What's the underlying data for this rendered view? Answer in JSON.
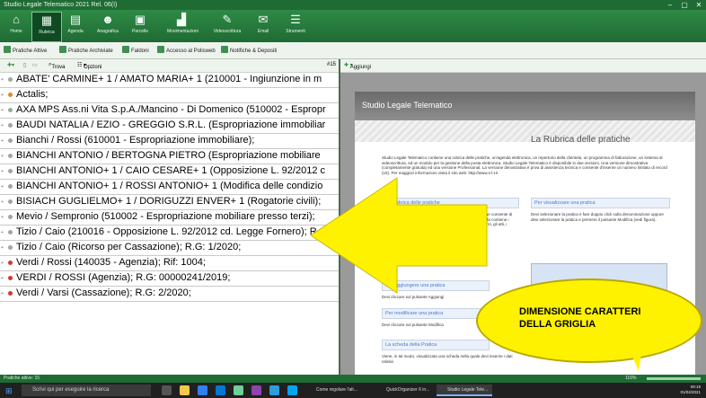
{
  "window": {
    "title": "Studio Legale Telematico 2021 Rel. 06(I)"
  },
  "ribbon": {
    "items": [
      {
        "label": "Home"
      },
      {
        "label": "Rubrica"
      },
      {
        "label": "Agenda"
      },
      {
        "label": "Anagrafica"
      },
      {
        "label": "Parcelle"
      },
      {
        "label": "Movimentazioni"
      },
      {
        "label": "Videoscrittura"
      },
      {
        "label": "Email"
      },
      {
        "label": "Strumenti"
      }
    ]
  },
  "subbar": {
    "items": [
      {
        "label": "Pratiche Attive"
      },
      {
        "label": "Pratiche Archiviate"
      },
      {
        "label": "Faldoni"
      },
      {
        "label": "Accesso al Polisweb"
      },
      {
        "label": "Notifiche & Depositi"
      }
    ]
  },
  "left_toolbar": {
    "find": "Trova",
    "options": "Opzioni",
    "count": "#15"
  },
  "right_toolbar": {
    "add": "Aggiungi"
  },
  "grid": {
    "rows": [
      {
        "text": "ABATE' CARMINE+ 1 / AMATO MARIA+ 1 (210001 - Ingiunzione in m",
        "status": "green"
      },
      {
        "text": "Actalis;",
        "status": "orange"
      },
      {
        "text": "AXA MPS Ass.ni Vita S.p.A./Mancino - Di Domenico (510002 - Espropr",
        "status": "green"
      },
      {
        "text": "BAUDI NATALIA / EZIO - GREGGIO S.R.L. (Espropriazione immobiliar",
        "status": "green"
      },
      {
        "text": "Bianchi / Rossi (610001 - Espropriazione immobiliare);",
        "status": "green"
      },
      {
        "text": "BIANCHI ANTONIO / BERTOGNA PIETRO (Espropriazione mobiliare",
        "status": "green"
      },
      {
        "text": "BIANCHI ANTONIO+ 1 / CAIO CESARE+ 1 (Opposizione L. 92/2012 c",
        "status": "green"
      },
      {
        "text": "BIANCHI ANTONIO+ 1 / ROSSI ANTONIO+ 1 (Modifica delle condizio",
        "status": "green"
      },
      {
        "text": "BISIACH GUGLIELMO+ 1 / DORIGUZZI ENVER+ 1 (Rogatorie civili);",
        "status": "green"
      },
      {
        "text": "Mevio / Sempronio (510002 - Espropriazione mobiliare presso terzi);",
        "status": "green"
      },
      {
        "text": "Tizio / Caio (210016 - Opposizione L. 92/2012 cd. Legge Fornero); R.G",
        "status": "green"
      },
      {
        "text": "Tizio / Caio (Ricorso per Cassazione); R.G: 1/2020;",
        "status": "green"
      },
      {
        "text": "Verdi / Rossi (140035 - Agenzia); Rif: 1004;",
        "status": "red"
      },
      {
        "text": "VERDI / ROSSI (Agenzia); R.G: 00000241/2019;",
        "status": "red"
      },
      {
        "text": "Verdi / Varsi (Cassazione); R.G: 2/2020;",
        "status": "red"
      }
    ]
  },
  "doc": {
    "header": "Studio Legale Telematico",
    "title": "La Rubrica delle pratiche",
    "intro": "Studio Legale Telematico contiene una rubrica delle pratiche, un'agenda elettronica, un repertorio della clientela, un programma di fatturazione, un sistema di videoscrittura, ed un modulo per la gestione della posta elettronica. Studio Legale Telematico è disponibile in due versioni. Una versione dimostrativa (completamente gratuita) ed una versione Professional. La versione dimostrativa è priva di assistenza tecnica e consente d'inserire un numero limitato di record (15). Per maggiori informazioni visita il sito web: http://www.s-l-t.it",
    "sections": [
      {
        "title": "La Rubrica delle pratiche",
        "body": "Il modulo principale del programma. La rubrica delle pratiche consente di raggruppare, in un'unica tabella, tutte le attività. Ogni cartella contiene i clienti, le controparti, i corrispondenti, le udienze, i documenti, gli atti, i memorandum, gli scadenzieri e le parcelle."
      },
      {
        "title": "Per visualizzare una pratica",
        "body": "Devi selezionare la pratica e fare doppio click sulla denominazione oppure devi selezionare la pratica e premere il pulsante Modifica (vedi figura)."
      },
      {
        "title": "Per aggiungere una pratica",
        "body": "Devi cliccare sul pulsante Aggiungi"
      },
      {
        "title": "Per modificare una pratica",
        "body": "Devi cliccare sul pulsante Modifica"
      },
      {
        "title": "La scheda della Pratica",
        "body": "Viene, in tal modo, visualizzata una scheda nella quale devi inserire i dati relativi"
      }
    ]
  },
  "callout": {
    "text": "DIMENSIONE CARATTERI DELLA GRIGLIA"
  },
  "status": {
    "left": "Pratiche attive: 15",
    "zoom": "116%"
  },
  "taskbar": {
    "search": "Scrivi qui per eseguire la ricerca",
    "apps": [
      {
        "label": "Come regolare l'alt..."
      },
      {
        "label": "QuickOrganizer 6 in..."
      },
      {
        "label": "Studio Legale Tele..."
      }
    ],
    "time": "09:19",
    "date": "01/04/2021"
  },
  "colors": {
    "accent": "#1f6b34",
    "callout": "#fff200",
    "arrow": "#fff200"
  }
}
